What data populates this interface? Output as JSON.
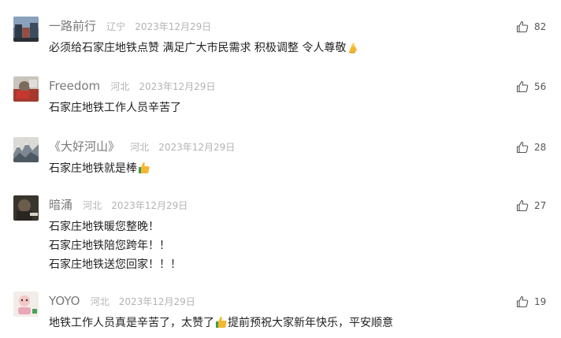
{
  "comments": [
    {
      "username": "一路前行",
      "location": "辽宁",
      "date": "2023年12月29日",
      "lines": [
        "必须给石家庄地铁点赞 满足广大市民需求 积极调整 令人尊敬"
      ],
      "likes": "82"
    },
    {
      "username": "Freedom",
      "location": "河北",
      "date": "2023年12月29日",
      "lines": [
        "石家庄地铁工作人员辛苦了"
      ],
      "likes": "56"
    },
    {
      "username": "《大好河山》",
      "location": "河北",
      "date": "2023年12月29日",
      "lines": [
        "石家庄地铁就是棒"
      ],
      "likes": "28"
    },
    {
      "username": "暗涌",
      "location": "河北",
      "date": "2023年12月29日",
      "lines": [
        "石家庄地铁暖您整晚！",
        "石家庄地铁陪您跨年！！",
        "石家庄地铁送您回家！！！"
      ],
      "likes": "27"
    },
    {
      "username": "YOYO",
      "location": "河北",
      "date": "2023年12月29日",
      "lines": [
        "地铁工作人员真是辛苦了，太赞了",
        "提前预祝大家新年快乐，平安顺意"
      ],
      "likes": "19"
    }
  ],
  "icons": {
    "like": "thumbs-up-outline-icon",
    "pray_emoji": "pray-emoji-icon",
    "thumbs_up_emoji": "thumbs-up-emoji-icon"
  },
  "colors": {
    "username": "#7a7a7a",
    "meta": "#b3b3b3",
    "text": "#222222",
    "like_count": "#555555"
  }
}
